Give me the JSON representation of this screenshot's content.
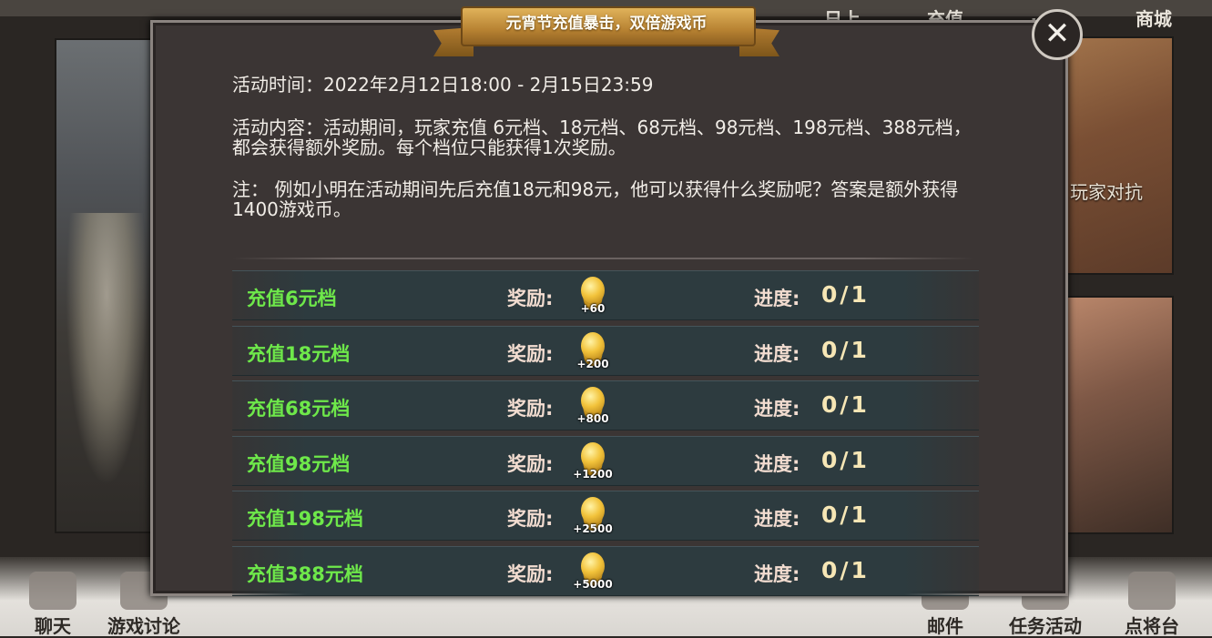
{
  "background": {
    "top_nav": [
      "日上",
      "充值",
      "…",
      "商城"
    ],
    "right_card_label": "玩家对抗",
    "bottom_nav": [
      {
        "label": "聊天",
        "icon": "chat-icon"
      },
      {
        "label": "游戏讨论",
        "icon": "discussion-icon"
      },
      {
        "label": "邮件",
        "icon": "mail-icon"
      },
      {
        "label": "任务活动",
        "icon": "quest-icon"
      },
      {
        "label": "点将台",
        "icon": "general-icon"
      }
    ]
  },
  "dialog": {
    "title": "元宵节充值暴击，双倍游戏币",
    "close_icon": "close-icon",
    "activity_time": "活动时间：2022年2月12日18:00 - 2月15日23:59",
    "activity_content": "活动内容：活动期间，玩家充值 6元档、18元档、68元档、98元档、198元档、388元档，都会获得额外奖励。每个档位只能获得1次奖励。",
    "note": "注： 例如小明在活动期间先后充值18元和98元，他可以获得什么奖励呢？答案是额外获得1400游戏币。",
    "reward_label": "奖励:",
    "progress_label": "进度:",
    "tiers": [
      {
        "name": "充值6元档",
        "reward": "+60",
        "progress": "0/1"
      },
      {
        "name": "充值18元档",
        "reward": "+200",
        "progress": "0/1"
      },
      {
        "name": "充值68元档",
        "reward": "+800",
        "progress": "0/1"
      },
      {
        "name": "充值98元档",
        "reward": "+1200",
        "progress": "0/1"
      },
      {
        "name": "充值198元档",
        "reward": "+2500",
        "progress": "0/1"
      },
      {
        "name": "充值388元档",
        "reward": "+5000",
        "progress": "0/1"
      }
    ]
  },
  "colors": {
    "tier_text": "#6ee84a",
    "label_text": "#f2dcd0",
    "banner_gold": "#b78232",
    "dialog_bg": "#3b3534"
  }
}
